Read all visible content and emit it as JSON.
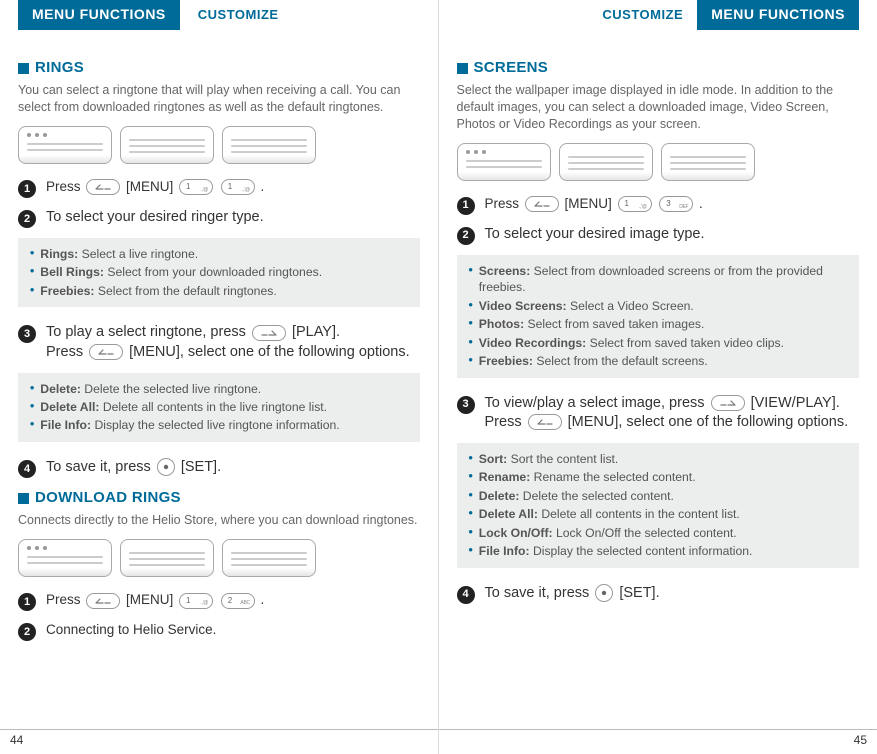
{
  "header": {
    "menu_functions": "MENU FUNCTIONS",
    "customize": "CUSTOMIZE"
  },
  "left": {
    "rings": {
      "title": "RINGS",
      "intro": "You can select a ringtone that will play when receiving a call. You can select from downloaded ringtones as well as the default ringtones.",
      "step1_a": "Press ",
      "step1_b": " [MENU] ",
      "step1_c": " .",
      "step2": "To select your desired ringer type.",
      "bullets1": [
        {
          "lbl": "Rings:",
          "txt": " Select a live ringtone."
        },
        {
          "lbl": "Bell Rings:",
          "txt": " Select from your downloaded ringtones."
        },
        {
          "lbl": "Freebies:",
          "txt": " Select from the default ringtones."
        }
      ],
      "step3_a": "To play a select ringtone, press ",
      "step3_b": " [PLAY].",
      "step3_c": "Press ",
      "step3_d": " [MENU], select one of the following options.",
      "bullets2": [
        {
          "lbl": "Delete:",
          "txt": " Delete the selected live ringtone."
        },
        {
          "lbl": "Delete All:",
          "txt": " Delete all contents in the live ringtone list."
        },
        {
          "lbl": "File Info:",
          "txt": " Display the selected live ringtone information."
        }
      ],
      "step4_a": "To save it, press  ",
      "step4_b": "  [SET]."
    },
    "download": {
      "title": "DOWNLOAD RINGS",
      "intro": "Connects directly to the Helio Store, where you can download ringtones.",
      "step1_a": "Press ",
      "step1_b": " [MENU] ",
      "step1_c": " .",
      "step2": "Connecting to Helio Service."
    },
    "page_number": "44"
  },
  "right": {
    "screens": {
      "title": "SCREENS",
      "intro": "Select the wallpaper image displayed in idle mode. In addition to the default images, you can select a downloaded image, Video Screen, Photos or Video Recordings as your screen.",
      "step1_a": "Press ",
      "step1_b": " [MENU] ",
      "step1_c": " .",
      "step2": "To select your desired image type.",
      "bullets1": [
        {
          "lbl": "Screens:",
          "txt": " Select from downloaded screens or from the provided freebies."
        },
        {
          "lbl": "Video Screens:",
          "txt": " Select a Video Screen."
        },
        {
          "lbl": "Photos:",
          "txt": " Select from saved taken images."
        },
        {
          "lbl": "Video Recordings:",
          "txt": " Select from saved taken video clips."
        },
        {
          "lbl": "Freebies:",
          "txt": " Select from the default screens."
        }
      ],
      "step3_a": "To view/play a select image, press ",
      "step3_b": " [VIEW/PLAY].",
      "step3_c": "Press ",
      "step3_d": " [MENU], select one of the following options.",
      "bullets2": [
        {
          "lbl": "Sort:",
          "txt": " Sort the content list."
        },
        {
          "lbl": "Rename:",
          "txt": " Rename the selected content."
        },
        {
          "lbl": "Delete:",
          "txt": " Delete the selected content."
        },
        {
          "lbl": "Delete All:",
          "txt": " Delete all contents in the content list."
        },
        {
          "lbl": "Lock On/Off:",
          "txt": " Lock On/Off the selected content."
        },
        {
          "lbl": "File Info:",
          "txt": " Display the selected content information."
        }
      ],
      "step4_a": "To save it, press  ",
      "step4_b": "  [SET]."
    },
    "page_number": "45"
  },
  "keys": {
    "k1": "1",
    "k1s": ".,'@",
    "k2": "2",
    "k2s": "ABC",
    "k3": "3",
    "k3s": "DEF"
  }
}
